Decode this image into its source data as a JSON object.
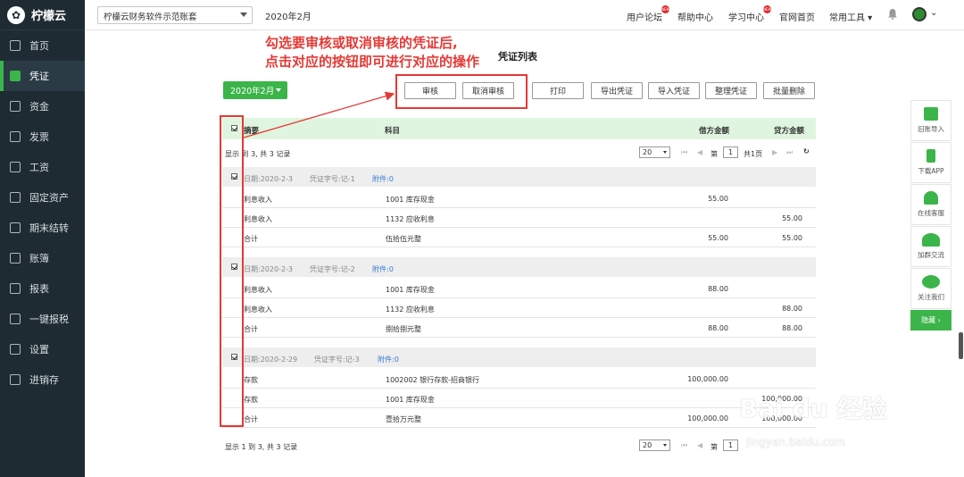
{
  "app": {
    "name": "柠檬云"
  },
  "sidebar": {
    "items": [
      {
        "label": "首页",
        "icon": "home-icon"
      },
      {
        "label": "凭证",
        "icon": "voucher-icon",
        "active": true
      },
      {
        "label": "资金",
        "icon": "fund-icon"
      },
      {
        "label": "发票",
        "icon": "invoice-icon"
      },
      {
        "label": "工资",
        "icon": "salary-icon"
      },
      {
        "label": "固定资产",
        "icon": "asset-icon"
      },
      {
        "label": "期末结转",
        "icon": "transfer-icon"
      },
      {
        "label": "账簿",
        "icon": "ledger-icon"
      },
      {
        "label": "报表",
        "icon": "report-icon"
      },
      {
        "label": "一键报税",
        "icon": "tax-icon"
      },
      {
        "label": "设置",
        "icon": "gear-icon"
      },
      {
        "label": "进销存",
        "icon": "inventory-icon"
      }
    ]
  },
  "topbar": {
    "account": "柠檬云财务软件示范账套",
    "period": "2020年2月",
    "links": [
      "用户论坛",
      "帮助中心",
      "学习中心",
      "官网首页",
      "常用工具 ▾"
    ],
    "badge": "NEW"
  },
  "annotation": {
    "line1": "勾选要审核或取消审核的凭证后,",
    "line2": "点击对应的按钮即可进行对应的操作"
  },
  "page": {
    "title": "凭证列表"
  },
  "toolbar": {
    "date": "2020年2月",
    "audit": "审核",
    "unaudit": "取消审核",
    "print": "打印",
    "export": "导出凭证",
    "import": "导入凭证",
    "organize": "整理凭证",
    "batch_delete": "批量删除"
  },
  "table": {
    "headers": {
      "summary": "摘要",
      "subject": "科目",
      "debit": "借方金额",
      "credit": "贷方金额"
    }
  },
  "pager": {
    "info_top": "显示 到 3, 共 3 记录",
    "info_bottom": "显示 1 到 3, 共 3 记录",
    "page_size": "20",
    "page_label": "第",
    "page": "1",
    "total_pages": "共1页"
  },
  "vouchers": [
    {
      "date": "日期:2020-2-3",
      "num": "凭证字号:记-1",
      "attach": "附件:0",
      "rows": [
        {
          "summary": "利息收入",
          "subject": "1001 库存现金",
          "debit": "55.00",
          "credit": ""
        },
        {
          "summary": "利息收入",
          "subject": "1132 应收利息",
          "debit": "",
          "credit": "55.00"
        },
        {
          "summary": "合计",
          "subject": "伍拾伍元整",
          "debit": "55.00",
          "credit": "55.00"
        }
      ]
    },
    {
      "date": "日期:2020-2-3",
      "num": "凭证字号:记-2",
      "attach": "附件:0",
      "rows": [
        {
          "summary": "利息收入",
          "subject": "1001 库存现金",
          "debit": "88.00",
          "credit": ""
        },
        {
          "summary": "利息收入",
          "subject": "1132 应收利息",
          "debit": "",
          "credit": "88.00"
        },
        {
          "summary": "合计",
          "subject": "捌拾捌元整",
          "debit": "88.00",
          "credit": "88.00"
        }
      ]
    },
    {
      "date": "日期:2020-2-29",
      "num": "凭证字号:记-3",
      "attach": "附件:0",
      "rows": [
        {
          "summary": "存款",
          "subject": "1002002 银行存款-招商银行",
          "debit": "100,000.00",
          "credit": ""
        },
        {
          "summary": "存款",
          "subject": "1001 库存现金",
          "debit": "",
          "credit": "100,000.00"
        },
        {
          "summary": "合计",
          "subject": "壹拾万元整",
          "debit": "100,000.00",
          "credit": "100,000.00"
        }
      ]
    }
  ],
  "right_panel": {
    "items": [
      "旧账导入",
      "下载APP",
      "在线客服",
      "加群交流",
      "关注我们"
    ],
    "hide": "隐藏 ›"
  },
  "watermark": {
    "line1": "Bai  du 经验",
    "line2": "jingyan.baidu.com"
  },
  "colors": {
    "accent": "#3bb54a",
    "highlight": "#e53935",
    "sidebar": "#1e2b33"
  }
}
